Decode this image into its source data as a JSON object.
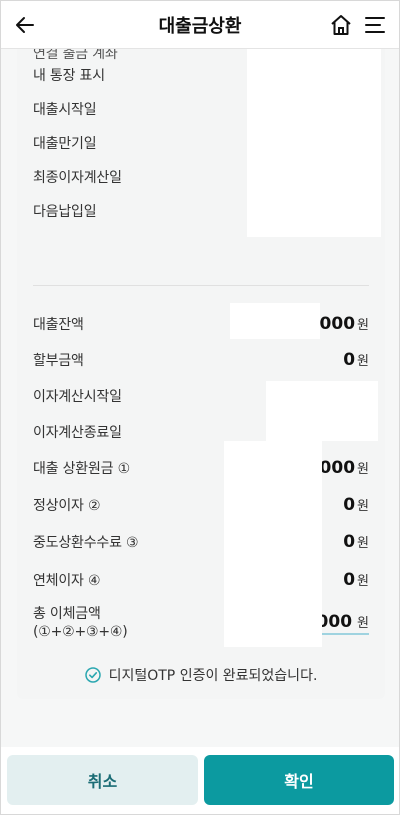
{
  "header": {
    "title": "대출금상환",
    "back_icon": "arrow-left-icon",
    "home_icon": "home-icon",
    "menu_icon": "hamburger-menu-icon"
  },
  "cut_row": {
    "label": "연결 출금 계좌"
  },
  "info_rows": [
    {
      "label": "내 통장 표시"
    },
    {
      "label": "대출시작일"
    },
    {
      "label": "대출만기일"
    },
    {
      "label": "최종이자계산일"
    },
    {
      "label": "다음납입일"
    }
  ],
  "amounts": {
    "loan_balance": {
      "label": "대출잔액",
      "value": ",000",
      "unit": "원"
    },
    "installment": {
      "label": "할부금액",
      "value": "0",
      "unit": "원"
    },
    "interest_start": {
      "label": "이자계산시작일"
    },
    "interest_end": {
      "label": "이자계산종료일"
    },
    "principal": {
      "label": "대출 상환원금 ①",
      "value": ",000",
      "unit": "원"
    },
    "normal_interest": {
      "label": "정상이자 ②",
      "value": "0",
      "unit": "원"
    },
    "prepayment_fee": {
      "label": "중도상환수수료 ③",
      "value": "0",
      "unit": "원"
    },
    "overdue_interest": {
      "label": "연체이자 ④",
      "value": "0",
      "unit": "원"
    },
    "total": {
      "label_line1": "총 이체금액",
      "label_line2": "(①+②+③+④)",
      "value": "000",
      "unit": "원"
    }
  },
  "otp": {
    "message": "디지털OTP 인증이 완료되었습니다.",
    "icon": "check-circle-icon"
  },
  "buttons": {
    "cancel": "취소",
    "confirm": "확인"
  },
  "colors": {
    "primary": "#0c9aa0",
    "cancel_bg": "#e3eff0",
    "cancel_text": "#1b6c75",
    "check": "#2aa7b0"
  }
}
